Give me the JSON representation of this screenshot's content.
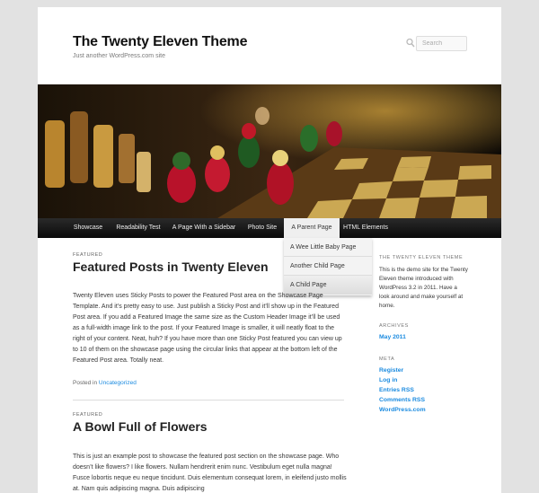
{
  "site": {
    "title": "The Twenty Eleven Theme",
    "description": "Just another WordPress.com site"
  },
  "search": {
    "placeholder": "Search"
  },
  "nav": {
    "items": [
      {
        "label": "Showcase"
      },
      {
        "label": "Readability Test"
      },
      {
        "label": "A Page With a Sidebar"
      },
      {
        "label": "Photo Site"
      },
      {
        "label": "A Parent Page"
      },
      {
        "label": "HTML Elements"
      }
    ],
    "active_index": 4,
    "dropdown": [
      "A Wee Little Baby Page",
      "Another Child Page",
      "A Child Page"
    ]
  },
  "posts": [
    {
      "kicker": "FEATURED",
      "title": "Featured Posts in Twenty Eleven",
      "body": "Twenty Eleven uses Sticky Posts to power the Featured Post area on the Showcase Page Template. And it’s pretty easy to use. Just publish a Sticky Post and it’ll show up in the Featured Post area. If you add a Featured Image the same size as the Custom Header Image it’ll be used as a full-width image link to the post. If your Featured Image is smaller, it will neatly float to the right of your content. Neat, huh? If you have more than one Sticky Post featured you can view up to 10 of them on the showcase page using the circular links that appear at the bottom left of the Featured Post area. Totally neat.",
      "footer_prefix": "Posted in",
      "footer_link": "Uncategorized"
    },
    {
      "kicker": "FEATURED",
      "title": "A Bowl Full of Flowers",
      "body": "This is just an example post to showcase the featured post section on the showcase page. Who doesn’t like flowers? I like flowers. Nullam hendrerit enim nunc. Vestibulum eget nulla magna! Fusce lobortis neque eu neque tincidunt. Duis elementum consequat lorem, in eleifend justo mollis at. Nam quis adipiscing magna. Duis adipiscing"
    }
  ],
  "sidebar": {
    "about_title": "THE TWENTY ELEVEN THEME",
    "about_text": "This is the demo site for the Twenty Eleven theme introduced with WordPress 3.2 in 2011. Have a look around and make yourself at home.",
    "archives_title": "ARCHIVES",
    "archives": [
      "May 2011"
    ],
    "meta_title": "META",
    "meta": [
      "Register",
      "Log in",
      "Entries RSS",
      "Comments RSS",
      "WordPress.com"
    ]
  },
  "colors": {
    "link": "#1b8be0",
    "nav_bg": "#0a0a0a",
    "page_bg": "#e2e2e2"
  },
  "icons": [
    "search-icon"
  ]
}
